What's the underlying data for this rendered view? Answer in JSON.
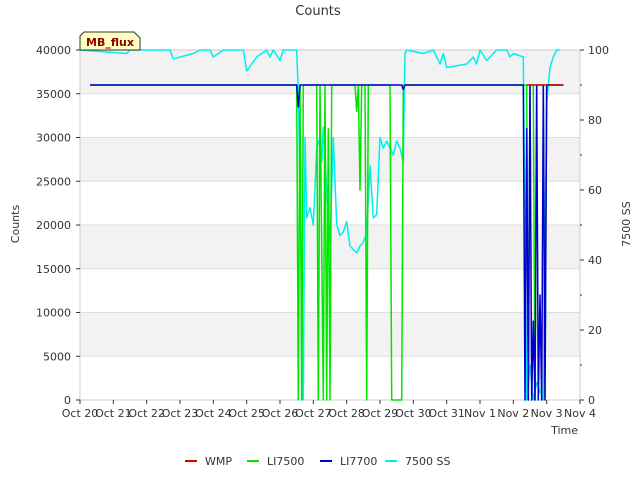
{
  "chart_data": {
    "type": "line",
    "title": "Counts",
    "xlabel": "Time",
    "ylabel": "Counts",
    "y2label": "7500 SS",
    "badge": "MB_flux",
    "xlim": [
      0,
      15
    ],
    "ylim": [
      0,
      40000
    ],
    "y2lim": [
      0,
      100
    ],
    "x_ticks": [
      "Oct 20",
      "Oct 21",
      "Oct 22",
      "Oct 23",
      "Oct 24",
      "Oct 25",
      "Oct 26",
      "Oct 27",
      "Oct 28",
      "Oct 29",
      "Oct 30",
      "Oct 31",
      "Nov 1",
      "Nov 2",
      "Nov 3",
      "Nov 4"
    ],
    "y_ticks": [
      0,
      5000,
      10000,
      15000,
      20000,
      25000,
      30000,
      35000,
      40000
    ],
    "y2_ticks": [
      0,
      20,
      40,
      60,
      80,
      100
    ],
    "grid": true,
    "legend_position": "bottom",
    "x_unit": "days since Oct 20",
    "series": [
      {
        "name": "WMP",
        "color": "#dd0000",
        "axis": "left",
        "points": [
          [
            13.4,
            36000
          ],
          [
            14.5,
            36000
          ]
        ]
      },
      {
        "name": "LI7500",
        "color": "#00e600",
        "axis": "left",
        "points": [
          [
            0.3,
            36000
          ],
          [
            6.5,
            36000
          ],
          [
            6.55,
            0
          ],
          [
            6.6,
            36000
          ],
          [
            6.65,
            0
          ],
          [
            6.7,
            36000
          ],
          [
            7.1,
            36000
          ],
          [
            7.15,
            0
          ],
          [
            7.2,
            36000
          ],
          [
            7.3,
            0
          ],
          [
            7.35,
            36000
          ],
          [
            7.4,
            0
          ],
          [
            7.45,
            31000
          ],
          [
            7.5,
            0
          ],
          [
            7.55,
            36000
          ],
          [
            8.25,
            36000
          ],
          [
            8.3,
            33000
          ],
          [
            8.35,
            36000
          ],
          [
            8.4,
            24000
          ],
          [
            8.45,
            36000
          ],
          [
            8.55,
            36000
          ],
          [
            8.6,
            0
          ],
          [
            8.65,
            36000
          ],
          [
            9.3,
            36000
          ],
          [
            9.35,
            0
          ],
          [
            9.65,
            0
          ],
          [
            9.7,
            36000
          ],
          [
            13.4,
            36000
          ],
          [
            13.45,
            0
          ],
          [
            13.5,
            36000
          ],
          [
            13.6,
            36000
          ],
          [
            13.65,
            0
          ],
          [
            13.7,
            36000
          ],
          [
            13.9,
            36000
          ],
          [
            13.95,
            0
          ],
          [
            14.0,
            36000
          ],
          [
            14.5,
            36000
          ]
        ]
      },
      {
        "name": "LI7700",
        "color": "#0000cc",
        "axis": "left",
        "points": [
          [
            0.3,
            36000
          ],
          [
            6.5,
            36000
          ],
          [
            6.55,
            33500
          ],
          [
            6.6,
            36000
          ],
          [
            9.65,
            36000
          ],
          [
            9.7,
            35500
          ],
          [
            9.75,
            36000
          ],
          [
            13.3,
            36000
          ],
          [
            13.35,
            0
          ],
          [
            13.4,
            31000
          ],
          [
            13.45,
            0
          ],
          [
            13.5,
            36000
          ],
          [
            13.55,
            0
          ],
          [
            13.6,
            9000
          ],
          [
            13.65,
            0
          ],
          [
            13.7,
            36000
          ],
          [
            13.75,
            0
          ],
          [
            13.8,
            12000
          ],
          [
            13.85,
            0
          ],
          [
            13.9,
            36000
          ],
          [
            13.95,
            0
          ],
          [
            14.0,
            36000
          ],
          [
            14.5,
            36000
          ]
        ]
      },
      {
        "name": "7500 SS",
        "color": "#00eeee",
        "axis": "right",
        "points": [
          [
            0,
            100
          ],
          [
            1.4,
            99
          ],
          [
            1.5,
            100
          ],
          [
            2.7,
            100
          ],
          [
            2.8,
            97.5
          ],
          [
            3.4,
            99
          ],
          [
            3.6,
            100
          ],
          [
            3.9,
            100
          ],
          [
            4.0,
            98
          ],
          [
            4.3,
            100
          ],
          [
            4.9,
            100
          ],
          [
            5.0,
            94
          ],
          [
            5.3,
            98
          ],
          [
            5.6,
            100
          ],
          [
            5.7,
            98
          ],
          [
            5.8,
            100
          ],
          [
            6.0,
            97
          ],
          [
            6.1,
            100
          ],
          [
            6.5,
            100
          ],
          [
            6.55,
            88
          ],
          [
            6.6,
            60
          ],
          [
            6.65,
            30
          ],
          [
            6.7,
            0
          ],
          [
            6.75,
            75
          ],
          [
            6.8,
            52
          ],
          [
            6.9,
            55
          ],
          [
            7.0,
            50
          ],
          [
            7.1,
            72
          ],
          [
            7.2,
            75
          ],
          [
            7.25,
            68
          ],
          [
            7.3,
            78
          ],
          [
            7.4,
            60
          ],
          [
            7.5,
            45
          ],
          [
            7.6,
            75
          ],
          [
            7.7,
            50
          ],
          [
            7.8,
            47
          ],
          [
            7.9,
            48
          ],
          [
            8.0,
            51
          ],
          [
            8.1,
            44
          ],
          [
            8.2,
            43
          ],
          [
            8.3,
            42
          ],
          [
            8.4,
            44
          ],
          [
            8.5,
            45
          ],
          [
            8.6,
            48
          ],
          [
            8.7,
            67
          ],
          [
            8.8,
            52
          ],
          [
            8.9,
            53
          ],
          [
            9.0,
            75
          ],
          [
            9.1,
            72
          ],
          [
            9.2,
            74
          ],
          [
            9.3,
            72
          ],
          [
            9.4,
            70
          ],
          [
            9.5,
            74
          ],
          [
            9.6,
            72
          ],
          [
            9.7,
            68
          ],
          [
            9.75,
            99
          ],
          [
            9.8,
            100
          ],
          [
            10.3,
            99
          ],
          [
            10.6,
            100
          ],
          [
            10.8,
            96
          ],
          [
            10.9,
            99
          ],
          [
            11.0,
            95
          ],
          [
            11.6,
            96
          ],
          [
            11.8,
            98
          ],
          [
            11.9,
            96
          ],
          [
            12.0,
            100
          ],
          [
            12.2,
            97
          ],
          [
            12.5,
            100
          ],
          [
            12.8,
            100
          ],
          [
            12.9,
            98
          ],
          [
            13.0,
            99
          ],
          [
            13.3,
            98
          ],
          [
            13.4,
            0
          ],
          [
            13.5,
            10
          ],
          [
            13.6,
            0
          ],
          [
            13.7,
            5
          ],
          [
            13.9,
            0
          ],
          [
            14.0,
            85
          ],
          [
            14.1,
            95
          ],
          [
            14.2,
            98
          ],
          [
            14.3,
            100
          ],
          [
            14.4,
            100
          ]
        ]
      }
    ]
  }
}
